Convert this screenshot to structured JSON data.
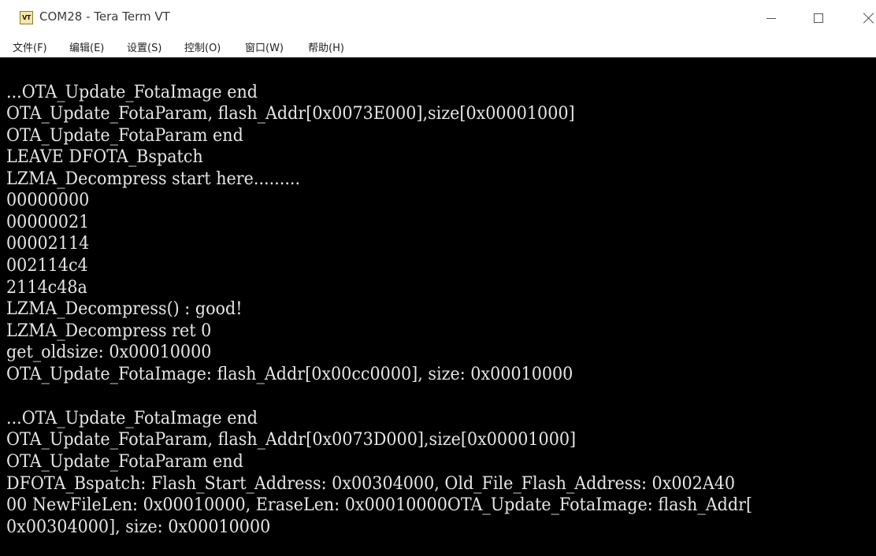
{
  "window": {
    "title": "COM28 - Tera Term VT",
    "icon_label": "VT"
  },
  "menu": [
    "文件(F)",
    "编辑(E)",
    "设置(S)",
    "控制(O)",
    "窗口(W)",
    "帮助(H)"
  ],
  "terminal": {
    "lines": [
      "...OTA_Update_FotaImage end",
      "OTA_Update_FotaParam, flash_Addr[0x0073E000],size[0x00001000]",
      "OTA_Update_FotaParam end",
      "LEAVE DFOTA_Bspatch",
      "LZMA_Decompress start here.........",
      "00000000",
      "00000021",
      "00002114",
      "002114c4",
      "2114c48a",
      "LZMA_Decompress() : good!",
      "LZMA_Decompress ret 0",
      "get_oldsize: 0x00010000",
      "OTA_Update_FotaImage: flash_Addr[0x00cc0000], size: 0x00010000",
      "",
      "...OTA_Update_FotaImage end",
      "OTA_Update_FotaParam, flash_Addr[0x0073D000],size[0x00001000]",
      "OTA_Update_FotaParam end",
      "DFOTA_Bspatch: Flash_Start_Address: 0x00304000, Old_File_Flash_Address: 0x002A40",
      "00 NewFileLen: 0x00010000, EraseLen: 0x00010000OTA_Update_FotaImage: flash_Addr[",
      "0x00304000], size: 0x00010000"
    ]
  }
}
